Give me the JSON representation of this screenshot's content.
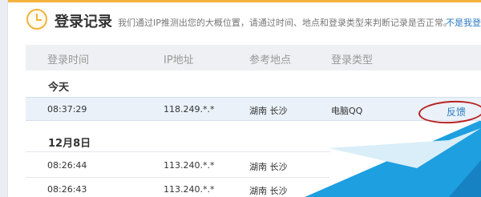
{
  "header": {
    "title": "登录记录",
    "subtitle": "我们通过IP推测出您的大概位置，请通过时间、地点和登录类型来判断记录是否正常。",
    "link": "不是我登"
  },
  "columns": [
    "登录时间",
    "IP地址",
    "参考地点",
    "登录类型"
  ],
  "groups": [
    {
      "label": "今天",
      "rows": [
        {
          "time": "08:37:29",
          "ip": "118.249.*.*",
          "location": "湖南 长沙",
          "type": "电脑QQ",
          "action": "反馈"
        }
      ]
    },
    {
      "label": "12月8日",
      "rows": [
        {
          "time": "08:26:44",
          "ip": "113.240.*.*",
          "location": "湖南 长沙",
          "type": ""
        },
        {
          "time": "08:26:43",
          "ip": "113.240.*.*",
          "location": "湖南 长沙",
          "type": ""
        }
      ]
    }
  ],
  "colors": {
    "accent": "#f3b33d",
    "link": "#2a7ac0",
    "highlight_row": "#eaf1f9",
    "header_row": "#eef0f3",
    "annotation": "#b92121",
    "decor_blue": "#29a3e0"
  },
  "icons": {
    "title_icon": "clock-icon"
  }
}
